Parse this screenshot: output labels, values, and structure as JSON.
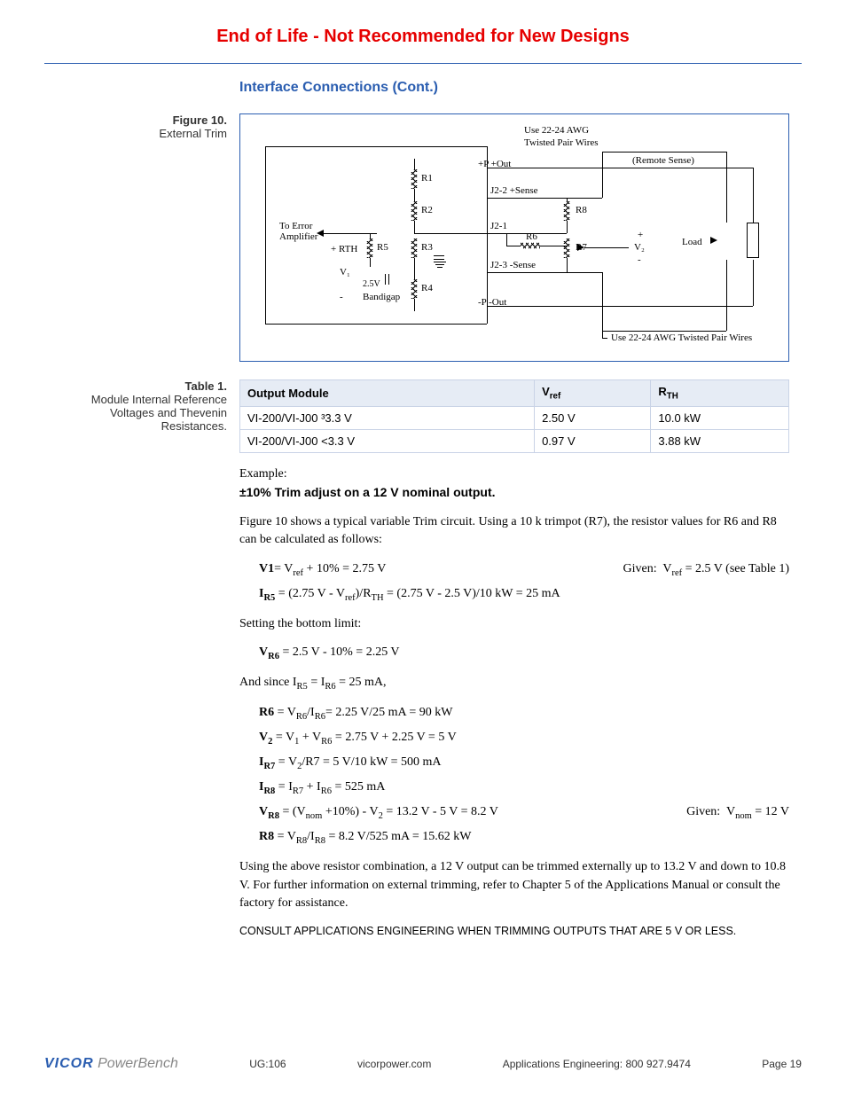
{
  "banner": "End of Life - Not Recommended for New Designs",
  "section_title": "Interface Connections (Cont.)",
  "figure": {
    "label": "Figure 10.",
    "caption": "External Trim",
    "labels": {
      "awg_top": "Use 22-24 AWG",
      "twisted": "Twisted Pair Wires",
      "remote_sense": "(Remote Sense)",
      "p_out_top": "+P  +Out",
      "r1": "R1",
      "j22_sense_p": "J2-2  +Sense",
      "r8": "R8",
      "r2": "R2",
      "to_err": "To Error",
      "amp": "Amplifier",
      "j21": "J2-1",
      "r6": "R6",
      "load": "Load",
      "rth": "+ RTH",
      "r5": "R5",
      "r3": "R3",
      "r7": "R7",
      "j23_sense_n": "J2-3  -Sense",
      "v1": "V₁",
      "v25": "2.5V",
      "r4": "R4",
      "bandigap": "Bandigap",
      "p_out_bot": "-P  -Out",
      "v2p": "+",
      "v2": "V₂",
      "v2n": "-",
      "awg_bot": "Use 22-24 AWG Twisted Pair Wires"
    }
  },
  "table": {
    "label": "Table 1.",
    "caption": "Module Internal Reference Voltages and Thevenin Resistances.",
    "headers": {
      "c1": "Output Module",
      "c2": "Vref",
      "c3": "RTH"
    },
    "rows": [
      {
        "c1": "VI-200/VI-J00   ³3.3 V",
        "c2": "2.50 V",
        "c3": "10.0 kW"
      },
      {
        "c1": "VI-200/VI-J00   <3.3 V",
        "c2": "0.97 V",
        "c3": "3.88 kW"
      }
    ]
  },
  "body": {
    "example": "Example:",
    "trim_title": "±10% Trim adjust on a 12 V nominal output.",
    "p1": "Figure 10 shows a typical variable Trim circuit. Using a 10 k trimpot (R7), the resistor values for R6 and R8 can be calculated as follows:",
    "eq1a_l": "V1= Vref + 10% = 2.75 V",
    "eq1a_r": "Given:  Vref = 2.5 V (see Table 1)",
    "eq1b": "IR5 = (2.75 V - Vref)/RTH = (2.75 V - 2.5 V)/10 kW = 25 mA",
    "p2": "Setting the bottom limit:",
    "eq2": "VR6 = 2.5 V - 10% = 2.25 V",
    "p3": "And since IR5 = IR6 = 25 mA,",
    "eq3a": "R6 = VR6/IR6= 2.25 V/25 mA = 90 kW",
    "eq3b": "V2 = V1 + VR6 = 2.75 V + 2.25 V = 5 V",
    "eq3c": "IR7 = V2/R7 = 5 V/10 kW = 500 mA",
    "eq3d": "IR8 = IR7 + IR6 = 525 mA",
    "eq3e_l": "VR8 = (Vnom +10%) - V2 = 13.2 V - 5 V = 8.2 V",
    "eq3e_r": "Given:  Vnom = 12 V",
    "eq3f": "R8 = VR8/IR8 = 8.2 V/525 mA = 15.62 kW",
    "p4": "Using the above resistor combination, a 12 V output can be trimmed externally up to 13.2 V and down to 10.8 V. For further information on external trimming, refer to Chapter 5 of the Applications Manual or consult the factory for assistance.",
    "note": "CONSULT APPLICATIONS ENGINEERING WHEN TRIMMING OUTPUTS THAT ARE 5 V OR LESS."
  },
  "footer": {
    "logo1": "VICOR",
    "logo2": " PowerBench",
    "doc": "UG:106",
    "url": "vicorpower.com",
    "contact": "Applications Engineering: 800 927.9474",
    "page": "Page 19"
  }
}
